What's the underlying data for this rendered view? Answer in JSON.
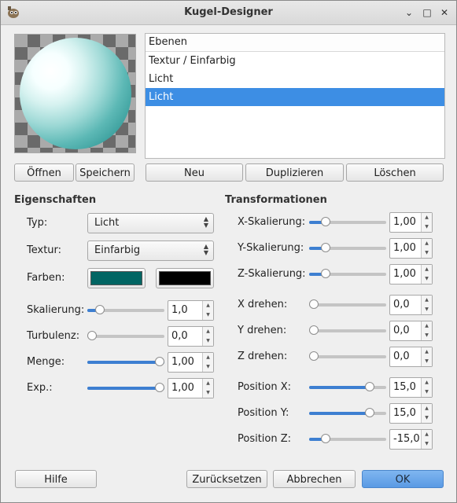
{
  "window": {
    "title": "Kugel-Designer"
  },
  "layers": {
    "header": "Ebenen",
    "items": [
      {
        "label": "Textur / Einfarbig",
        "selected": false
      },
      {
        "label": "Licht",
        "selected": false
      },
      {
        "label": "Licht",
        "selected": true
      }
    ]
  },
  "buttons": {
    "open": "Öffnen",
    "save": "Speichern",
    "new": "Neu",
    "duplicate": "Duplizieren",
    "delete": "Löschen",
    "help": "Hilfe",
    "reset": "Zurücksetzen",
    "cancel": "Abbrechen",
    "ok": "OK"
  },
  "properties": {
    "title": "Eigenschaften",
    "type_label": "Typ:",
    "type_value": "Licht",
    "texture_label": "Textur:",
    "texture_value": "Einfarbig",
    "colors_label": "Farben:",
    "color1": "#026563",
    "color2": "#000000",
    "sliders": [
      {
        "label": "Skalierung:",
        "value": "1,0",
        "fraction": 0.12
      },
      {
        "label": "Turbulenz:",
        "value": "0,0",
        "fraction": 0.0
      },
      {
        "label": "Menge:",
        "value": "1,00",
        "fraction": 1.0
      },
      {
        "label": "Exp.:",
        "value": "1,00",
        "fraction": 1.0
      }
    ]
  },
  "transformations": {
    "title": "Transformationen",
    "sliders": [
      {
        "label": "X-Skalierung:",
        "value": "1,00",
        "fraction": 0.18
      },
      {
        "label": "Y-Skalierung:",
        "value": "1,00",
        "fraction": 0.18
      },
      {
        "label": "Z-Skalierung:",
        "value": "1,00",
        "fraction": 0.18
      },
      {
        "label": "X drehen:",
        "value": "0,0",
        "fraction": 0.0
      },
      {
        "label": "Y drehen:",
        "value": "0,0",
        "fraction": 0.0
      },
      {
        "label": "Z drehen:",
        "value": "0,0",
        "fraction": 0.0
      },
      {
        "label": "Position X:",
        "value": "15,0",
        "fraction": 0.82
      },
      {
        "label": "Position Y:",
        "value": "15,0",
        "fraction": 0.82
      },
      {
        "label": "Position Z:",
        "value": "-15,0",
        "fraction": 0.18
      }
    ]
  },
  "accent_color": "#3d8ee4"
}
